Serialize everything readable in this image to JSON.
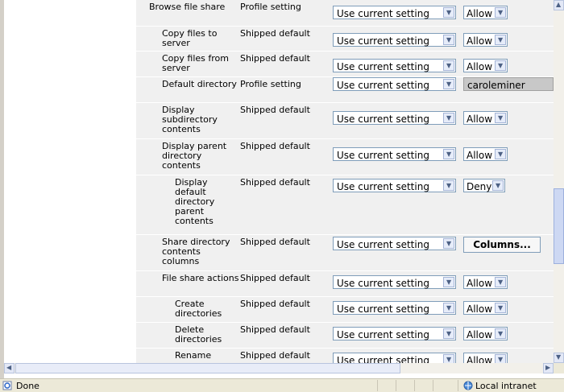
{
  "rows": [
    {
      "name": "Browse file share",
      "source": "Profile setting",
      "setting": "Use current setting",
      "perm": "Allow",
      "type": "perm"
    },
    {
      "name": "Copy files to server",
      "source": "Shipped default",
      "setting": "Use current setting",
      "perm": "Allow",
      "type": "perm"
    },
    {
      "name": "Copy files from server",
      "source": "Shipped default",
      "setting": "Use current setting",
      "perm": "Allow",
      "type": "perm"
    },
    {
      "name": "Default directory",
      "source": "Profile setting",
      "setting": "Use current setting",
      "perm": "caroleminer",
      "type": "text"
    },
    {
      "name": "Display subdirectory contents",
      "source": "Shipped default",
      "setting": "Use current setting",
      "perm": "Allow",
      "type": "perm"
    },
    {
      "name": "Display parent directory contents",
      "source": "Shipped default",
      "setting": "Use current setting",
      "perm": "Allow",
      "type": "perm"
    },
    {
      "name": "Display default directory parent contents",
      "source": "Shipped default",
      "setting": "Use current setting",
      "perm": "Deny",
      "type": "perm"
    },
    {
      "name": "Share directory contents columns",
      "source": "Shipped default",
      "setting": "Use current setting",
      "perm": "Columns...",
      "type": "button"
    },
    {
      "name": "File share actions",
      "source": "Shipped default",
      "setting": "Use current setting",
      "perm": "Allow",
      "type": "perm"
    },
    {
      "name": "Create directories",
      "source": "Shipped default",
      "setting": "Use current setting",
      "perm": "Allow",
      "type": "perm"
    },
    {
      "name": "Delete directories",
      "source": "Shipped default",
      "setting": "Use current setting",
      "perm": "Allow",
      "type": "perm"
    },
    {
      "name": "Rename",
      "source": "Shipped default",
      "setting": "Use current setting",
      "perm": "Allow",
      "type": "perm"
    }
  ],
  "statusbar": {
    "status": "Done",
    "zone": "Local intranet"
  },
  "icons": {
    "dropdown": "chevron-down-icon",
    "ie": "ie-page-icon",
    "zone": "local-intranet-icon"
  },
  "colors": {
    "row_bg": "#f0f0f0",
    "text_field_bg": "#c8c8c8"
  }
}
